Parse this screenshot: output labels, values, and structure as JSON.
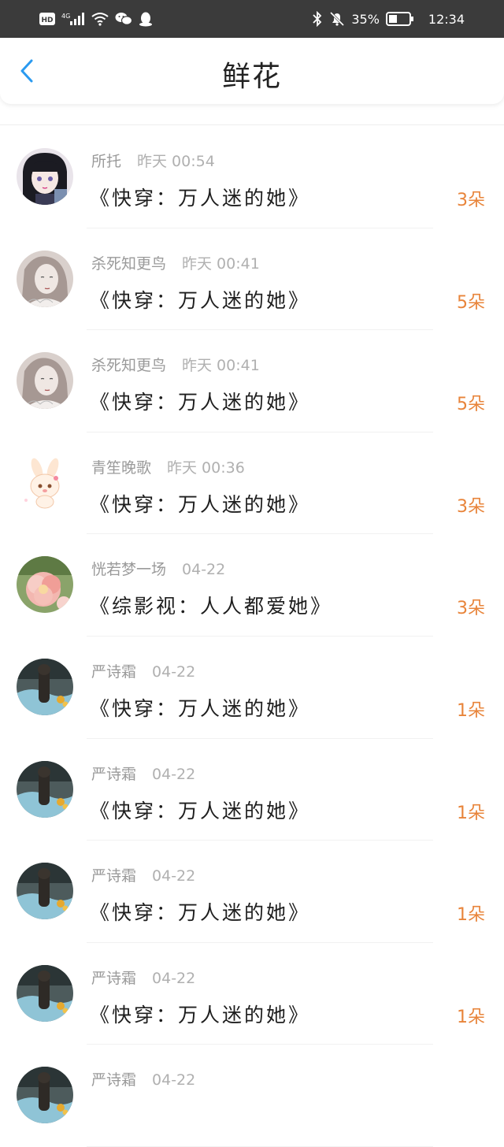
{
  "status_bar": {
    "left_icons": [
      "hd-icon",
      "signal-4g-icon",
      "wifi-icon",
      "wechat-icon",
      "qq-icon"
    ],
    "hd_label": "HD",
    "net_label": "4G",
    "battery_percent": "35%",
    "time": "12:34"
  },
  "header": {
    "title": "鲜花",
    "back_icon": "chevron-left-icon"
  },
  "colors": {
    "accent_back": "#2a9af0",
    "count_orange": "#e8843a",
    "status_bar_bg": "#3b3b3b"
  },
  "rows": [
    {
      "user": "所托",
      "time": "昨天 00:54",
      "book": "《快穿：万人迷的她》",
      "count": "3朵",
      "avatar": "anime-girl-black-hair"
    },
    {
      "user": "杀死知更鸟",
      "time": "昨天 00:41",
      "book": "《快穿：万人迷的她》",
      "count": "5朵",
      "avatar": "sketch-girl"
    },
    {
      "user": "杀死知更鸟",
      "time": "昨天 00:41",
      "book": "《快穿：万人迷的她》",
      "count": "5朵",
      "avatar": "sketch-girl"
    },
    {
      "user": "青笙晚歌",
      "time": "昨天 00:36",
      "book": "《快穿：万人迷的她》",
      "count": "3朵",
      "avatar": "cartoon-bunny"
    },
    {
      "user": "恍若梦一场",
      "time": "04-22",
      "book": "《综影视：人人都爱她》",
      "count": "3朵",
      "avatar": "pink-flower"
    },
    {
      "user": "严诗霜",
      "time": "04-22",
      "book": "《快穿：万人迷的她》",
      "count": "1朵",
      "avatar": "cat-photo"
    },
    {
      "user": "严诗霜",
      "time": "04-22",
      "book": "《快穿：万人迷的她》",
      "count": "1朵",
      "avatar": "cat-photo"
    },
    {
      "user": "严诗霜",
      "time": "04-22",
      "book": "《快穿：万人迷的她》",
      "count": "1朵",
      "avatar": "cat-photo"
    },
    {
      "user": "严诗霜",
      "time": "04-22",
      "book": "《快穿：万人迷的她》",
      "count": "1朵",
      "avatar": "cat-photo"
    },
    {
      "user": "严诗霜",
      "time": "04-22",
      "book": "",
      "count": "",
      "avatar": "cat-photo"
    }
  ]
}
